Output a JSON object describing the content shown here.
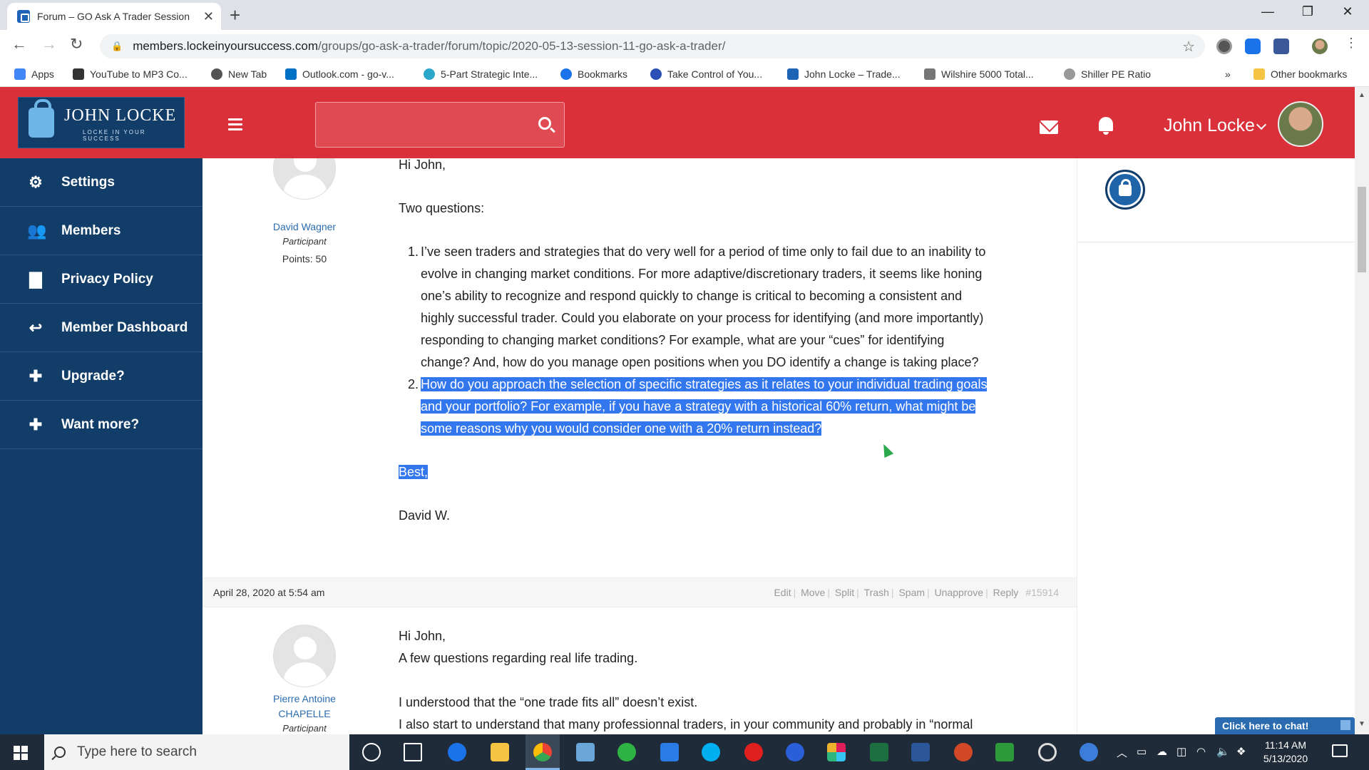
{
  "browser": {
    "tab_title": "Forum – GO Ask A Trader Session",
    "url_host": "members.lockeinyoursuccess.com",
    "url_path": "/groups/go-ask-a-trader/forum/topic/2020-05-13-session-11-go-ask-a-trader/",
    "bookmarks": [
      {
        "label": "Apps",
        "color": "#4285f4"
      },
      {
        "label": "YouTube to MP3 Co...",
        "color": "#333333"
      },
      {
        "label": "New Tab",
        "color": "#555555"
      },
      {
        "label": "Outlook.com - go-v...",
        "color": "#0072c6"
      },
      {
        "label": "5-Part Strategic Inte...",
        "color": "#2aa7c9"
      },
      {
        "label": "Bookmarks",
        "color": "#1a73e8"
      },
      {
        "label": "Take Control of You...",
        "color": "#2a4fb5"
      },
      {
        "label": "John Locke – Trade...",
        "color": "#1e63b6"
      },
      {
        "label": "Wilshire 5000 Total...",
        "color": "#777777"
      },
      {
        "label": "Shiller PE Ratio",
        "color": "#999999"
      }
    ],
    "more_bookmarks": "»",
    "other_bookmarks": "Other bookmarks"
  },
  "header": {
    "logo_name": "JOHN LOCKE",
    "logo_tagline": "LOCKE IN YOUR SUCCESS",
    "user_name": "John Locke",
    "accent_color": "#d9303a"
  },
  "sidebar": {
    "items": [
      {
        "label": "Settings",
        "icon": "gears-icon"
      },
      {
        "label": "Members",
        "icon": "users-icon"
      },
      {
        "label": "Privacy Policy",
        "icon": "document-icon"
      },
      {
        "label": "Member Dashboard",
        "icon": "reply-all-icon"
      },
      {
        "label": "Upgrade?",
        "icon": "plus-icon"
      },
      {
        "label": "Want more?",
        "icon": "plus-icon"
      }
    ]
  },
  "post1": {
    "author_name": "David Wagner",
    "author_role": "Participant",
    "author_points": "Points: 50",
    "greeting": "Hi John,",
    "intro": "Two questions:",
    "items": [
      {
        "num": "1.",
        "lines": [
          "I’ve seen traders and strategies that do very well for a period of time only to fail due to an inability to",
          "evolve in changing market conditions.  For more adaptive/discretionary traders, it seems like honing",
          "one’s ability to recognize and respond quickly to change is critical to becoming a consistent and",
          "highly successful trader.  Could you elaborate on your process for identifying (and more importantly)",
          "responding to changing market conditions?  For example, what are your “cues” for identifying",
          "change?  And, how do you manage open positions when you DO identify a change is taking place?"
        ]
      },
      {
        "num": "2.",
        "lines": [
          "How do you approach the selection of specific strategies as it relates to your individual trading goals",
          "and your portfolio?  For example, if you have a strategy with a historical 60% return, what might be",
          "some reasons why you would consider one with a 20% return instead?"
        ]
      }
    ],
    "signoff": "Best,",
    "signature": "David W."
  },
  "post2": {
    "date": "April 28, 2020 at 5:54 am",
    "actions": [
      "Edit",
      "Move",
      "Split",
      "Trash",
      "Spam",
      "Unapprove",
      "Reply"
    ],
    "post_id": "#15914",
    "author_name": "Pierre Antoine CHAPELLE",
    "author_role": "Participant",
    "lines": [
      "Hi John,",
      "A few questions regarding real life trading.",
      "",
      "I understood that the “one trade fits all” doesn’t exist.",
      "I also start to understand that many professionnal traders, in your community and probably in “normal"
    ]
  },
  "chat": {
    "label": "Click here to chat!"
  },
  "taskbar": {
    "search_placeholder": "Type here to search",
    "time": "11:14 AM",
    "date": "5/13/2020"
  }
}
